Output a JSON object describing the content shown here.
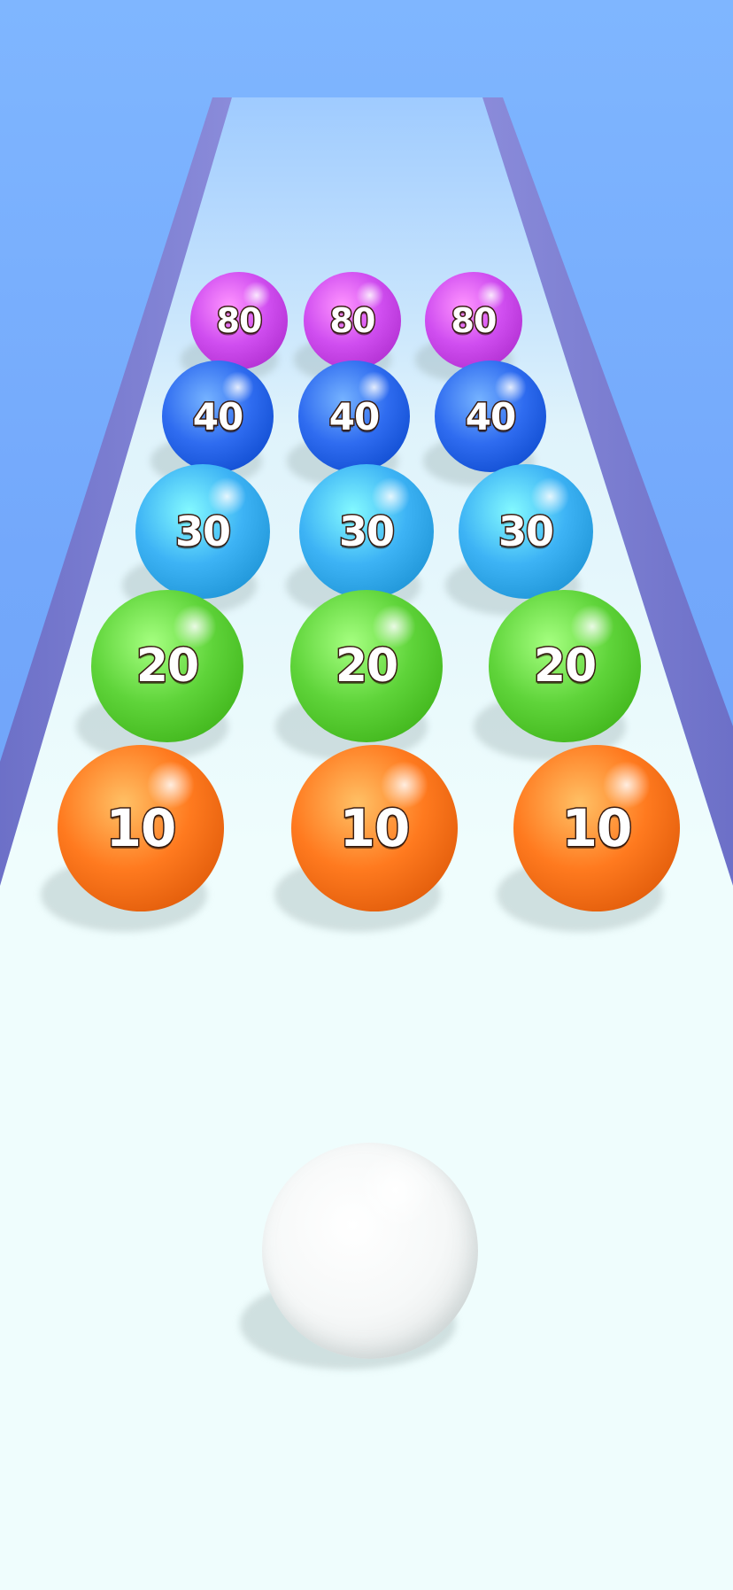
{
  "colors": {
    "sky": "#7fb6ff",
    "track": "#effdfd",
    "rail": "#7b78c9",
    "orange": "#ff7a1f",
    "green": "#5fd43a",
    "light_blue": "#3db3f5",
    "blue": "#2f6cf0",
    "purple": "#d04ef0",
    "white": "#ffffff"
  },
  "balls": {
    "row_80": [
      "80",
      "80",
      "80"
    ],
    "row_40": [
      "40",
      "40",
      "40"
    ],
    "row_30": [
      "30",
      "30",
      "30"
    ],
    "row_20": [
      "20",
      "20",
      "20"
    ],
    "row_10": [
      "10",
      "10",
      "10"
    ]
  },
  "player": {
    "label": ""
  }
}
